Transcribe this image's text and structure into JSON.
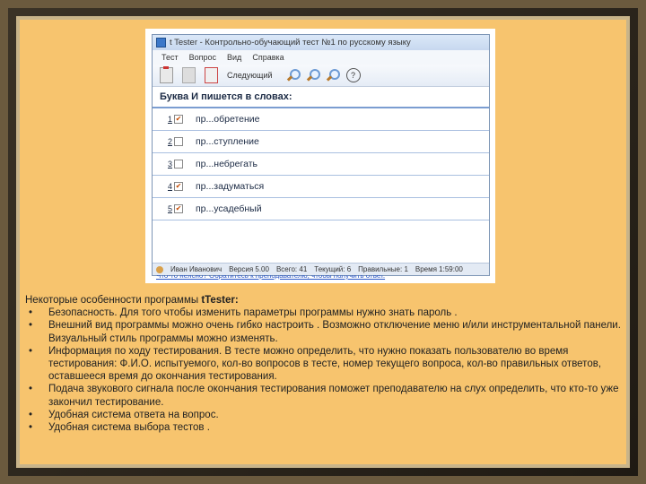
{
  "window": {
    "title": "t Tester - Контрольно-обучающий тест №1 по русскому языку",
    "menu": [
      "Тест",
      "Вопрос",
      "Вид",
      "Справка"
    ],
    "next_label": "Следующий"
  },
  "question": {
    "text": "Буква И пишется в словах:",
    "answers": [
      {
        "num": "1",
        "checked": true,
        "text": "пр...обретение"
      },
      {
        "num": "2",
        "checked": false,
        "text": "пр...ступление"
      },
      {
        "num": "3",
        "checked": false,
        "text": "пр...небрегать"
      },
      {
        "num": "4",
        "checked": true,
        "text": "пр...задуматься"
      },
      {
        "num": "5",
        "checked": true,
        "text": "пр...усадебный"
      }
    ],
    "hint_link": "Что-то неясно? Обратитесь к преподавателю, чтобы получить ответ."
  },
  "status": {
    "user": "Иван Иванович",
    "version": "Версия 5.00",
    "total": "Всего: 41",
    "current": "Текущий: 6",
    "correct": "Правильные: 1",
    "time": "Время 1:59:00"
  },
  "text": {
    "title_prefix": "Некоторые особенности программы ",
    "title_bold": "tTester:",
    "bullets": [
      "Безопасность. Для того чтобы изменить параметры программы нужно знать пароль .",
      "Внешний вид программы можно очень гибко настроить . Возможно отключение меню и/или инструментальной панели. Визуальный стиль программы можно изменять.",
      "Информация по ходу тестирования. В тесте можно определить, что нужно показать пользователю во время тестирования: Ф.И.О. испытуемого, кол-во вопросов в тесте, номер текущего вопроса, кол-во правильных ответов, оставшееся время до окончания тестирования.",
      "Подача звукового сигнала после окончания тестирования поможет преподавателю на слух определить, что кто-то уже закончил тестирование.",
      "Удобная система ответа на вопрос.",
      "Удобная система выбора тестов ."
    ]
  }
}
